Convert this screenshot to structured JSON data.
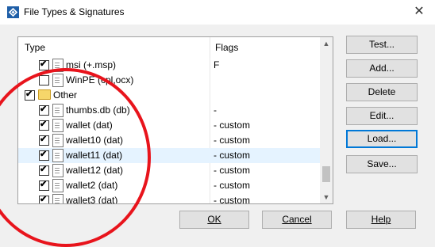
{
  "window": {
    "title": "File Types & Signatures",
    "close_glyph": "✕"
  },
  "list": {
    "columns": {
      "type": "Type",
      "flags": "Flags"
    },
    "rows": [
      {
        "label": "msi (+.msp)",
        "flag": "F",
        "checked": true,
        "icon": "file-icon",
        "indent": 1,
        "selected": false
      },
      {
        "label": "WinPE (cpl,ocx)",
        "flag": "",
        "checked": false,
        "icon": "file-icon",
        "indent": 1,
        "selected": false
      },
      {
        "label": "Other",
        "flag": "",
        "checked": true,
        "icon": "folder-icon",
        "indent": 0,
        "selected": false
      },
      {
        "label": "thumbs.db (db)",
        "flag": "-",
        "checked": true,
        "icon": "file-icon",
        "indent": 1,
        "selected": false
      },
      {
        "label": "wallet (dat)",
        "flag": "- custom",
        "checked": true,
        "icon": "file-icon",
        "indent": 1,
        "selected": false
      },
      {
        "label": "wallet10 (dat)",
        "flag": "- custom",
        "checked": true,
        "icon": "file-icon",
        "indent": 1,
        "selected": false
      },
      {
        "label": "wallet11 (dat)",
        "flag": "- custom",
        "checked": true,
        "icon": "file-icon",
        "indent": 1,
        "selected": true
      },
      {
        "label": "wallet12 (dat)",
        "flag": "- custom",
        "checked": true,
        "icon": "file-icon",
        "indent": 1,
        "selected": false
      },
      {
        "label": "wallet2 (dat)",
        "flag": "- custom",
        "checked": true,
        "icon": "file-icon",
        "indent": 1,
        "selected": false
      },
      {
        "label": "wallet3 (dat)",
        "flag": "- custom",
        "checked": true,
        "icon": "file-icon",
        "indent": 1,
        "selected": false
      }
    ]
  },
  "side_buttons": {
    "test": "Test...",
    "add": "Add...",
    "delete": "Delete",
    "edit": "Edit...",
    "load": "Load...",
    "save": "Save..."
  },
  "bottom_buttons": {
    "ok": "OK",
    "cancel": "Cancel",
    "help": "Help"
  },
  "annotation_color": "#e8141c"
}
